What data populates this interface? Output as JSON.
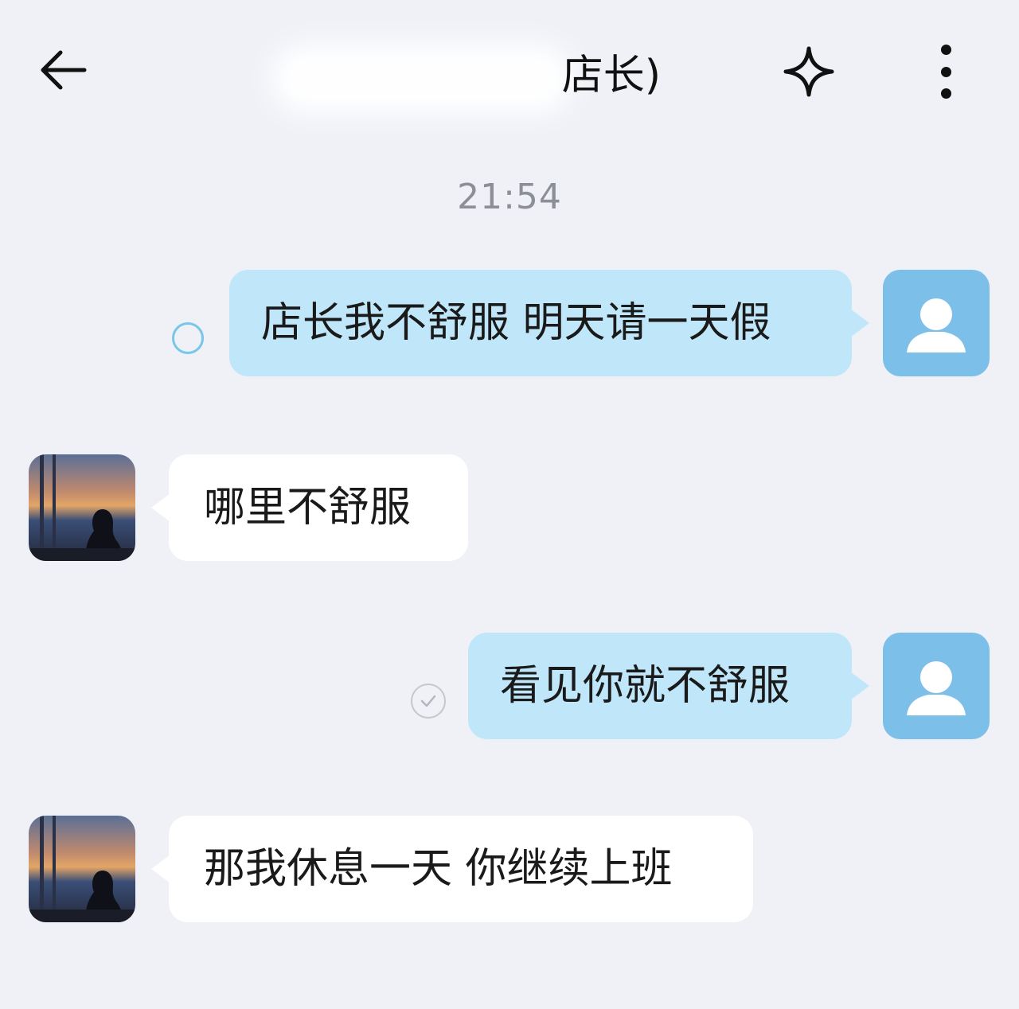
{
  "header": {
    "back_label": "back",
    "title": "店长)",
    "star_label": "favorite",
    "more_label": "more"
  },
  "timestamp": "21:54",
  "messages": [
    {
      "sender": "self",
      "text": "店长我不舒服 明天请一天假",
      "status": "sending"
    },
    {
      "sender": "other",
      "text": "哪里不舒服"
    },
    {
      "sender": "self",
      "text": "看见你就不舒服",
      "status": "read"
    },
    {
      "sender": "other",
      "text": "那我休息一天 你继续上班"
    }
  ],
  "icons": {
    "back": "arrow-left-icon",
    "star": "sparkle-star-icon",
    "more": "vertical-dots-icon",
    "self_avatar": "default-user-icon",
    "read": "check-icon"
  },
  "colors": {
    "background": "#eff1f7",
    "outgoing_bubble": "#c0e6f9",
    "incoming_bubble": "#ffffff",
    "self_avatar": "#7cbfe9",
    "status_circle": "#78c6e8",
    "timestamp": "#8c8f96"
  }
}
